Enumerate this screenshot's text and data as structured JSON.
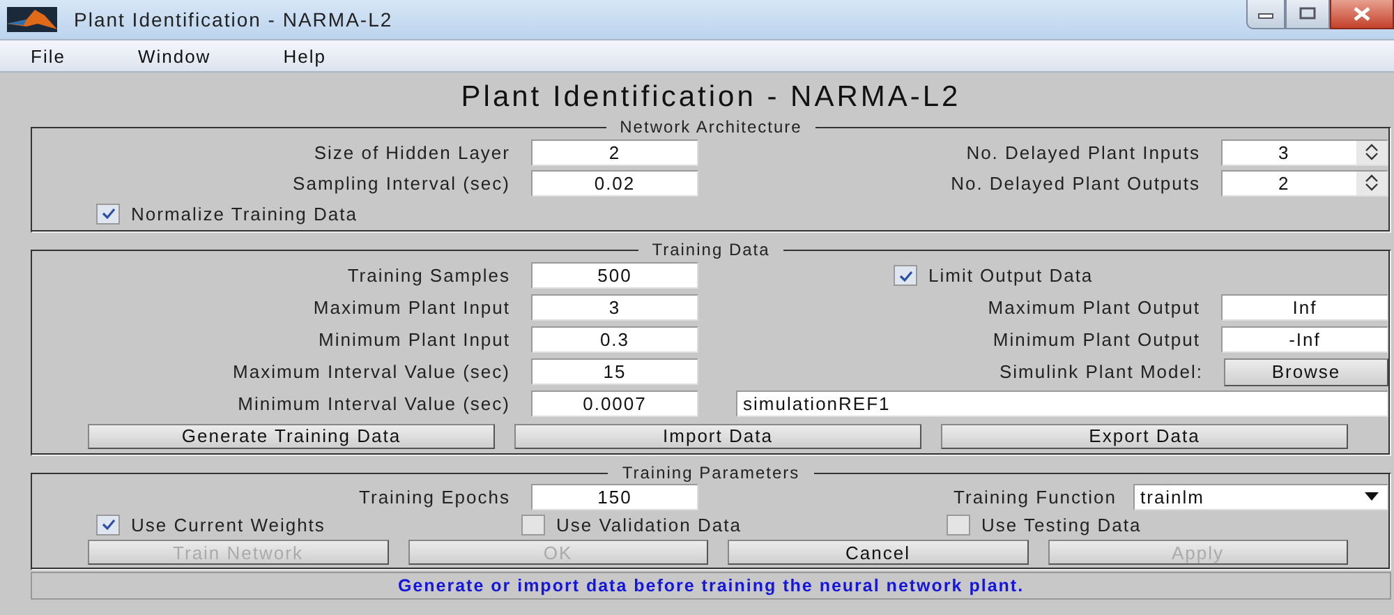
{
  "window": {
    "title": "Plant Identification - NARMA-L2"
  },
  "menu": [
    "File",
    "Window",
    "Help"
  ],
  "heading": "Plant Identification - NARMA-L2",
  "panels": [
    {
      "title": "Network Architecture",
      "rows": [
        {
          "kind": "pair",
          "left": {
            "kind": "field",
            "label": "Size of Hidden Layer",
            "value": "2"
          },
          "right": {
            "kind": "spinner",
            "label": "No. Delayed Plant Inputs",
            "value": "3"
          }
        },
        {
          "kind": "pair",
          "left": {
            "kind": "field",
            "label": "Sampling Interval (sec)",
            "value": "0.02"
          },
          "right": {
            "kind": "spinner",
            "label": "No. Delayed Plant Outputs",
            "value": "2"
          }
        },
        {
          "kind": "checks",
          "items": [
            {
              "label": "Normalize Training Data",
              "checked": true
            }
          ]
        }
      ]
    },
    {
      "title": "Training Data",
      "rows": [
        {
          "kind": "pair",
          "left": {
            "kind": "field",
            "label": "Training Samples",
            "value": "500"
          },
          "right": {
            "kind": "checkbox",
            "label": "Limit Output Data",
            "checked": true
          }
        },
        {
          "kind": "pair",
          "left": {
            "kind": "field",
            "label": "Maximum Plant Input",
            "value": "3"
          },
          "right": {
            "kind": "field",
            "label": "Maximum Plant Output",
            "value": "Inf"
          }
        },
        {
          "kind": "pair",
          "left": {
            "kind": "field",
            "label": "Minimum Plant Input",
            "value": "0.3"
          },
          "right": {
            "kind": "field",
            "label": "Minimum Plant Output",
            "value": "-Inf"
          }
        },
        {
          "kind": "pair",
          "left": {
            "kind": "field",
            "label": "Maximum Interval Value (sec)",
            "value": "15"
          },
          "right": {
            "kind": "button",
            "label": "Simulink Plant Model:",
            "value": "Browse"
          }
        },
        {
          "kind": "pair",
          "left": {
            "kind": "field",
            "label": "Minimum Interval Value (sec)",
            "value": "0.0007"
          },
          "right": {
            "kind": "path",
            "value": "simulationREF1"
          }
        },
        {
          "kind": "buttons",
          "items": [
            {
              "label": "Generate Training Data",
              "disabled": false
            },
            {
              "label": "Import Data",
              "disabled": false
            },
            {
              "label": "Export Data",
              "disabled": false
            }
          ]
        }
      ]
    },
    {
      "title": "Training Parameters",
      "rows": [
        {
          "kind": "pair",
          "left": {
            "kind": "field",
            "label": "Training Epochs",
            "value": "150"
          },
          "right": {
            "kind": "dropdown",
            "label": "Training Function",
            "value": "trainlm"
          }
        },
        {
          "kind": "checks",
          "items": [
            {
              "label": "Use Current Weights",
              "checked": true
            },
            {
              "label": "Use Validation Data",
              "checked": false
            },
            {
              "label": "Use Testing Data",
              "checked": false
            }
          ]
        },
        {
          "kind": "buttons",
          "items": [
            {
              "label": "Train Network",
              "disabled": true
            },
            {
              "label": "OK",
              "disabled": true
            },
            {
              "label": "Cancel",
              "disabled": false
            },
            {
              "label": "Apply",
              "disabled": true
            }
          ]
        }
      ]
    }
  ],
  "status": "Generate or import data before training the neural network plant."
}
